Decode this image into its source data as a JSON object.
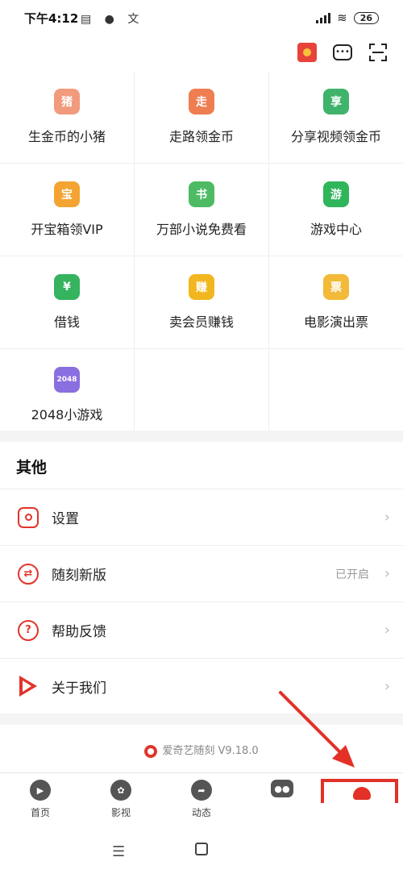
{
  "status": {
    "time": "下午4:12",
    "battery": "26",
    "notif_icons": "▤ ● 文"
  },
  "top_actions": {
    "chat_glyph": "•••"
  },
  "grid": [
    {
      "label": "生金币的小猪",
      "icon": "pig-icon",
      "color": "#f29a7c",
      "glyph": "猪"
    },
    {
      "label": "走路领金币",
      "icon": "walking-icon",
      "color": "#ef7d52",
      "glyph": "走"
    },
    {
      "label": "分享视频领金币",
      "icon": "share-video-icon",
      "color": "#3fb36b",
      "glyph": "享"
    },
    {
      "label": "开宝箱领VIP",
      "icon": "treasure-chest-icon",
      "color": "#f4a433",
      "glyph": "宝"
    },
    {
      "label": "万部小说免费看",
      "icon": "book-icon",
      "color": "#4dbb63",
      "glyph": "书"
    },
    {
      "label": "游戏中心",
      "icon": "game-center-icon",
      "color": "#2fb55a",
      "glyph": "游"
    },
    {
      "label": "借钱",
      "icon": "money-bag-icon",
      "color": "#35b35f",
      "glyph": "¥"
    },
    {
      "label": "卖会员赚钱",
      "icon": "earn-coin-icon",
      "color": "#f2b71f",
      "glyph": "赚"
    },
    {
      "label": "电影演出票",
      "icon": "ticket-cat-icon",
      "color": "#f3b939",
      "glyph": "票"
    },
    {
      "label": "2048小游戏",
      "icon": "game-2048-icon",
      "color": "#8a6fe0",
      "glyph": "2048"
    }
  ],
  "others": {
    "title": "其他",
    "items": [
      {
        "label": "设置",
        "value": ""
      },
      {
        "label": "随刻新版",
        "value": "已开启"
      },
      {
        "label": "帮助反馈",
        "value": ""
      },
      {
        "label": "关于我们",
        "value": ""
      }
    ]
  },
  "version": "爱奇艺随刻 V9.18.0",
  "tabs": [
    {
      "label": "首页",
      "icon": "home-icon"
    },
    {
      "label": "影视",
      "icon": "film-reel-icon"
    },
    {
      "label": "动态",
      "icon": "share-arrow-icon"
    },
    {
      "label": "",
      "icon": "game-controller-icon"
    },
    {
      "label": "",
      "icon": "profile-icon"
    }
  ],
  "colors": {
    "accent": "#e0352b",
    "annotation": "#e33127"
  }
}
